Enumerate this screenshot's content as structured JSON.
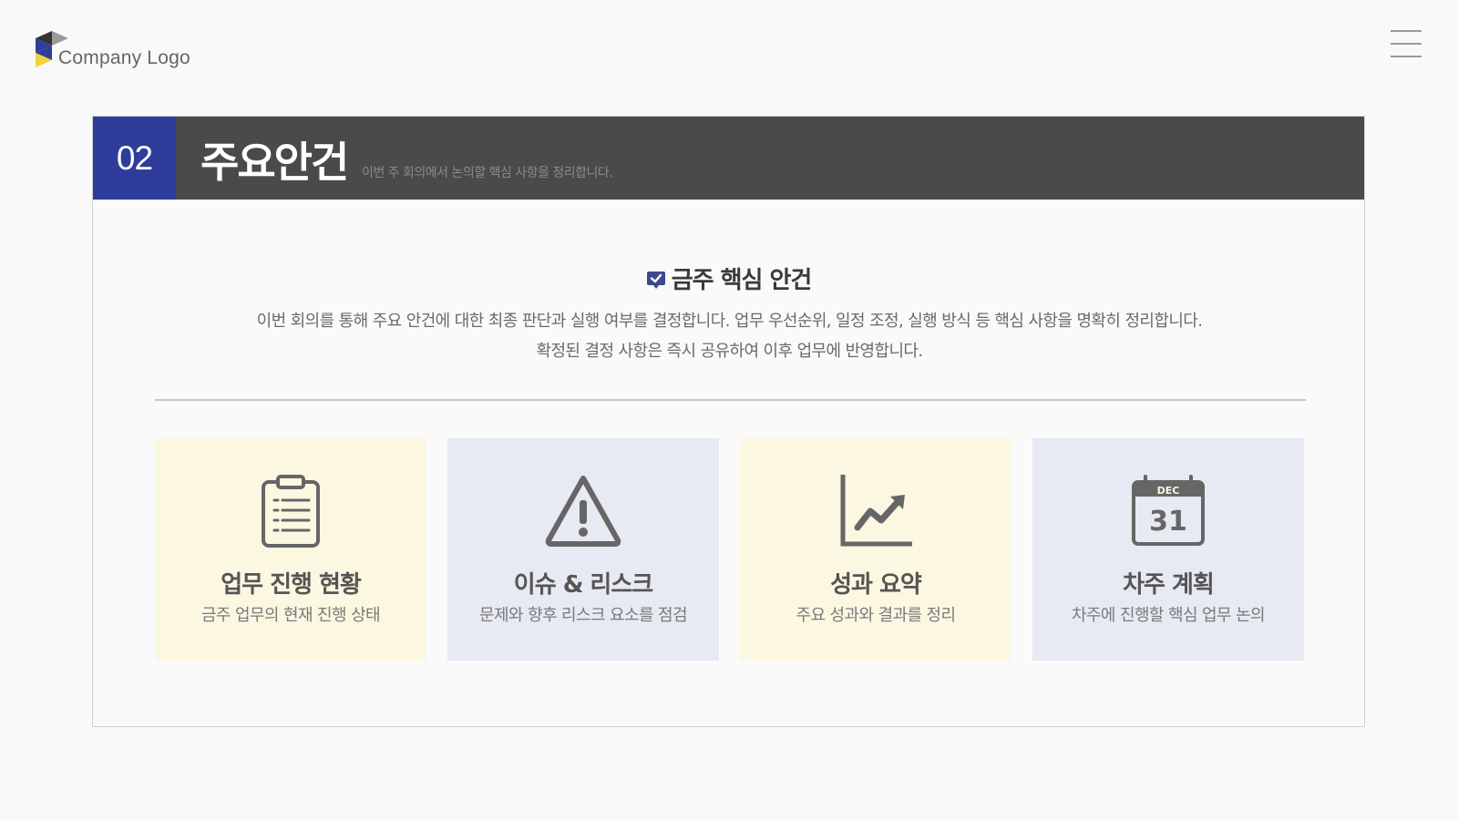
{
  "logo": {
    "text": "Company Logo"
  },
  "header": {
    "number": "02",
    "title": "주요안건",
    "subtitle": "이번 주 회의에서 논의할 핵심 사항을 정리합니다."
  },
  "section": {
    "heading": "금주 핵심 안건",
    "desc_line1": "이번 회의를 통해 주요 안건에 대한 최종 판단과 실행 여부를 결정합니다. 업무 우선순위, 일정 조정, 실행 방식 등 핵심 사항을 명확히 정리합니다.",
    "desc_line2": "확정된 결정 사항은 즉시 공유하여 이후 업무에 반영합니다."
  },
  "cards": [
    {
      "icon": "clipboard-icon",
      "title": "업무 진행 현황",
      "subtitle": "금주 업무의 현재 진행 상태",
      "bg": "#fbf7e1"
    },
    {
      "icon": "warning-icon",
      "title": "이슈 & 리스크",
      "subtitle": "문제와 향후 리스크 요소를 점검",
      "bg": "#e7e9f3"
    },
    {
      "icon": "chart-trend-icon",
      "title": "성과 요약",
      "subtitle": "주요 성과와 결과를 정리",
      "bg": "#fbf7e1"
    },
    {
      "icon": "calendar-icon",
      "title": "차주 계획",
      "subtitle": "차주에 진행할 핵심 업무 논의",
      "bg": "#e7e9f3"
    }
  ],
  "calendar_icon": {
    "month": "DEC",
    "day": "31"
  },
  "colors": {
    "accent": "#2e3d9b",
    "header_bg": "#4a4a4a",
    "logo_yellow": "#f2d23c",
    "logo_gray": "#9a9a9a",
    "icon_color": "#666666"
  }
}
